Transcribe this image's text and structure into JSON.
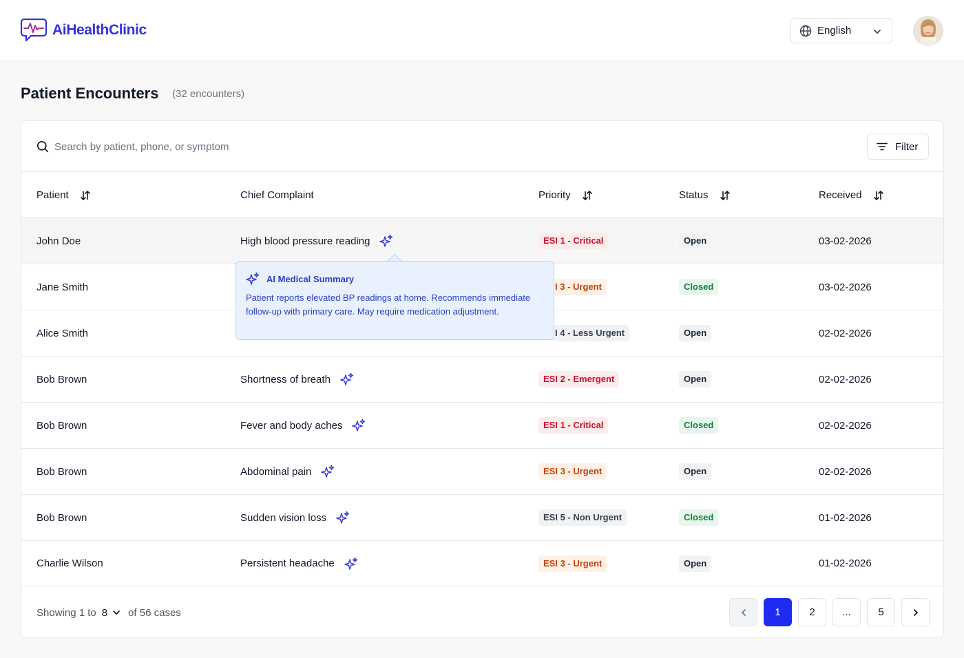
{
  "app": {
    "name": "AiHealthClinic"
  },
  "header": {
    "language": "English"
  },
  "page": {
    "title": "Patient Encounters",
    "count": "(32 encounters)"
  },
  "search": {
    "placeholder": "Search by patient, phone, or symptom",
    "value": ""
  },
  "filter": {
    "label": "Filter"
  },
  "table": {
    "columns": [
      "Patient",
      "Chief Complaint",
      "Priority",
      "Status",
      "Received"
    ],
    "rows": [
      {
        "patient": "John Doe",
        "complaint": "High blood pressure reading",
        "priority": "ESI 1 - Critical",
        "status": "Open",
        "received": "03-02-2026"
      },
      {
        "patient": "Jane Smith",
        "complaint": "",
        "priority": "I 3 - Urgent",
        "status": "Closed",
        "received": "03-02-2026"
      },
      {
        "patient": "Alice Smith",
        "complaint": "",
        "priority": "I 4 - Less Urgent",
        "status": "Open",
        "received": "02-02-2026"
      },
      {
        "patient": "Bob Brown",
        "complaint": "Shortness of breath",
        "priority": "ESI 2 - Emergent",
        "status": "Open",
        "received": "02-02-2026"
      },
      {
        "patient": "Bob Brown",
        "complaint": "Fever and body aches",
        "priority": "ESI 1 - Critical",
        "status": "Closed",
        "received": "02-02-2026"
      },
      {
        "patient": "Bob Brown",
        "complaint": "Abdominal pain",
        "priority": "ESI 3 - Urgent",
        "status": "Open",
        "received": "02-02-2026"
      },
      {
        "patient": "Bob Brown",
        "complaint": "Sudden vision loss",
        "priority": "ESI 5 - Non Urgent",
        "status": "Closed",
        "received": "01-02-2026"
      },
      {
        "patient": "Charlie Wilson",
        "complaint": "Persistent headache",
        "priority": "ESI 3 - Urgent",
        "status": "Open",
        "received": "01-02-2026"
      }
    ]
  },
  "tooltip": {
    "title": "AI Medical Summary",
    "body": "Patient reports elevated BP readings at home. Recommends immediate follow-up with primary care. May require medication adjustment."
  },
  "footer": {
    "showing": "Showing 1 to",
    "per_page": "8",
    "total": "of 56 cases",
    "pages": [
      "1",
      "2",
      "...",
      "5"
    ]
  },
  "colors": {
    "brand": "#3330e0",
    "active_page": "#1d2cf0",
    "critical": "#c8102e",
    "urgent": "#c2410c",
    "closed": "#15803d",
    "tooltip_bg": "#e8f1fd"
  },
  "icons": [
    "logo-chat-heartbeat-icon",
    "globe-icon",
    "chevron-down-icon",
    "search-icon",
    "filter-icon",
    "sort-icon",
    "ai-sparkle-icon",
    "chevron-left-icon",
    "chevron-right-icon"
  ]
}
